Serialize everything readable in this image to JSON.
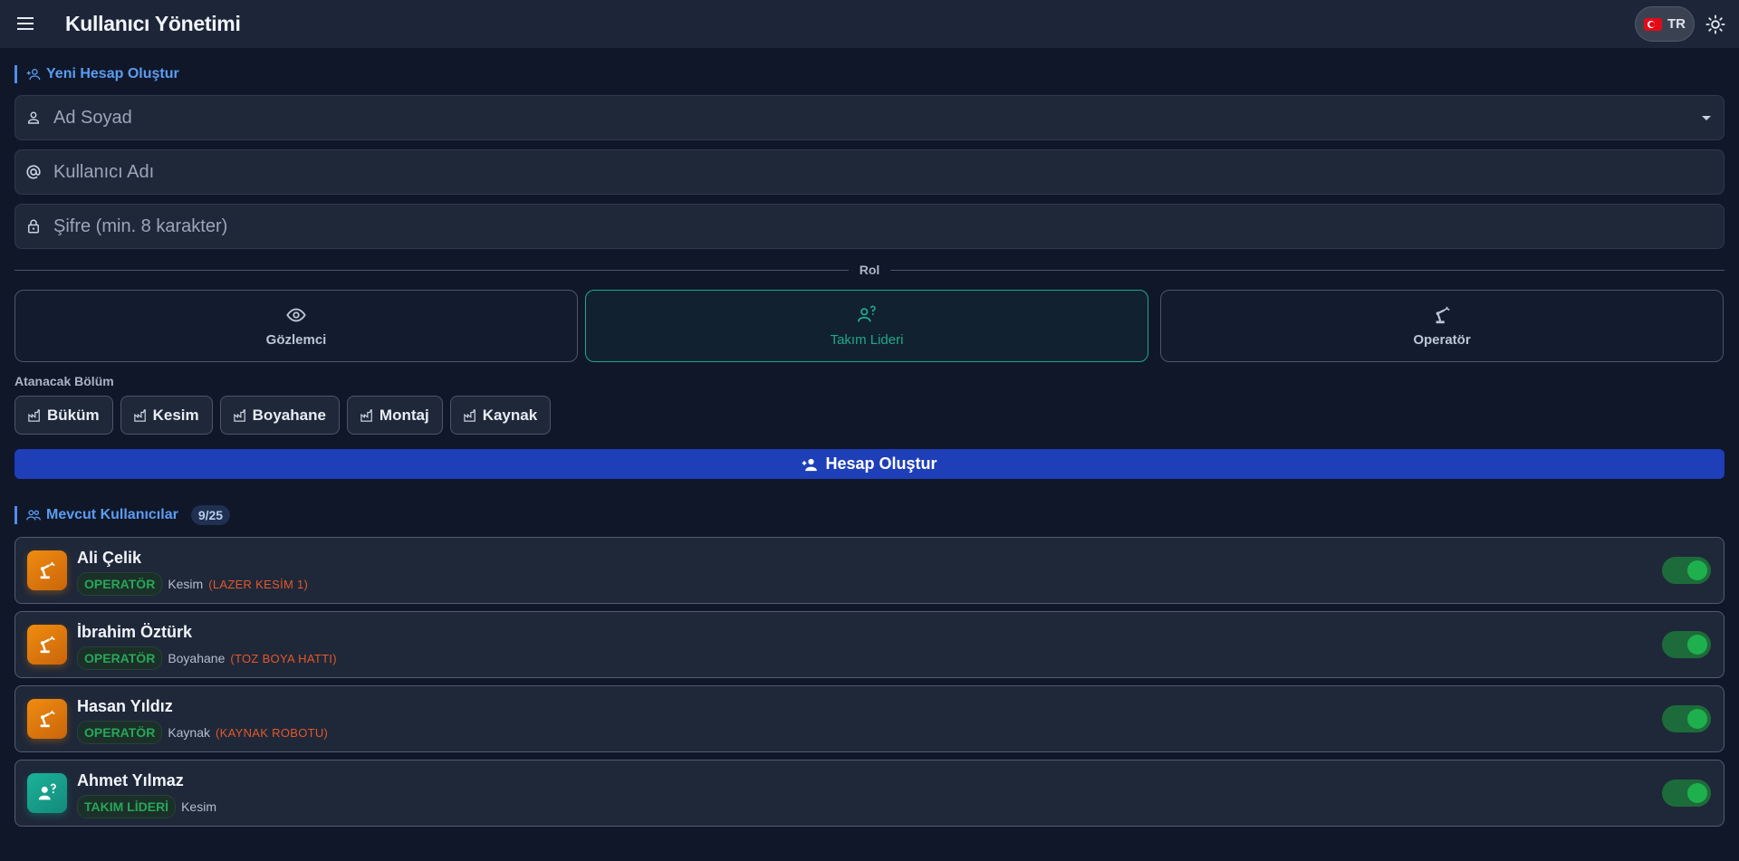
{
  "app": {
    "title": "Kullanıcı Yönetimi",
    "language": "TR"
  },
  "create_section": {
    "title": "Yeni Hesap Oluştur",
    "fields": {
      "full_name_placeholder": "Ad Soyad",
      "username_placeholder": "Kullanıcı Adı",
      "password_placeholder": "Şifre (min. 8 karakter)"
    },
    "role_label": "Rol",
    "roles": [
      {
        "label": "Gözlemci",
        "icon": "eye-icon",
        "selected": false
      },
      {
        "label": "Takım Lideri",
        "icon": "team-leader-icon",
        "selected": true
      },
      {
        "label": "Operatör",
        "icon": "robot-arm-icon",
        "selected": false
      }
    ],
    "department_label": "Atanacak Bölüm",
    "departments": [
      "Büküm",
      "Kesim",
      "Boyahane",
      "Montaj",
      "Kaynak"
    ],
    "submit_label": "Hesap Oluştur"
  },
  "users_section": {
    "title": "Mevcut Kullanıcılar",
    "count": "9/25",
    "users": [
      {
        "name": "Ali Çelik",
        "role": "OPERATÖR",
        "department": "Kesim",
        "station": "(LAZER KESİM 1)",
        "avatar": "orange",
        "active": true
      },
      {
        "name": "İbrahim Öztürk",
        "role": "OPERATÖR",
        "department": "Boyahane",
        "station": "(TOZ BOYA HATTI)",
        "avatar": "orange",
        "active": true
      },
      {
        "name": "Hasan Yıldız",
        "role": "OPERATÖR",
        "department": "Kaynak",
        "station": "(KAYNAK ROBOTU)",
        "avatar": "orange",
        "active": true
      },
      {
        "name": "Ahmet Yılmaz",
        "role": "TAKIM LİDERİ",
        "department": "Kesim",
        "station": "",
        "avatar": "teal",
        "active": true
      }
    ]
  },
  "colors": {
    "accent": "#5c9cf0",
    "primary_button": "#1e3fb8",
    "selected_role": "#1ea88a",
    "operator_avatar": "#f08c10",
    "leader_avatar": "#1bb29a",
    "badge_text": "#27a75a",
    "station_text": "#e2582a"
  }
}
